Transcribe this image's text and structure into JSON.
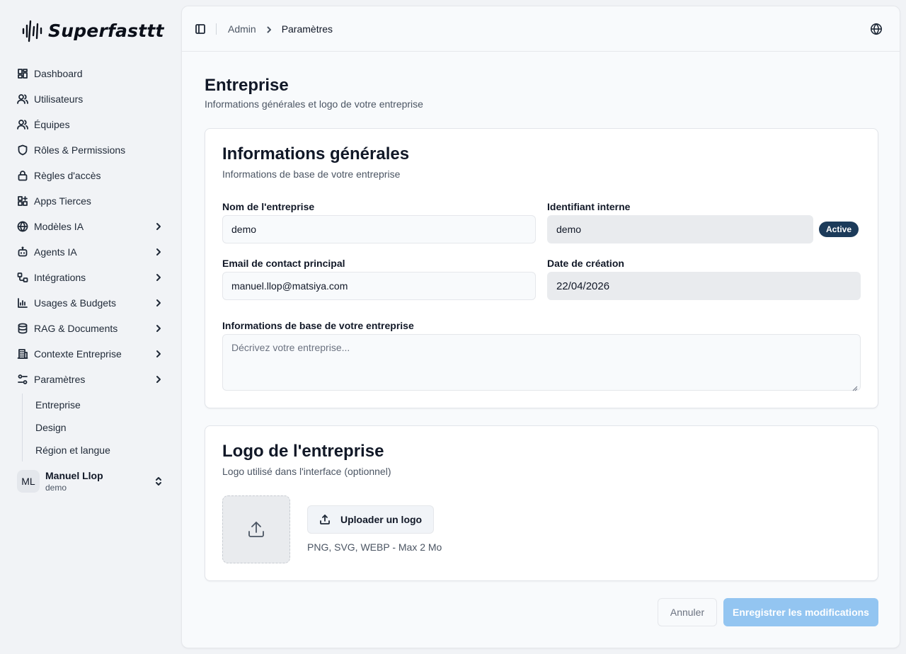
{
  "brand": {
    "name": "Superfasttt"
  },
  "sidebar": {
    "items": [
      {
        "label": "Dashboard",
        "icon": "dashboard-icon",
        "chevron": false
      },
      {
        "label": "Utilisateurs",
        "icon": "users-icon",
        "chevron": false
      },
      {
        "label": "Équipes",
        "icon": "teams-icon",
        "chevron": false
      },
      {
        "label": "Rôles & Permissions",
        "icon": "shield-icon",
        "chevron": false
      },
      {
        "label": "Règles d'accès",
        "icon": "lock-icon",
        "chevron": false
      },
      {
        "label": "Apps Tierces",
        "icon": "apps-icon",
        "chevron": false
      },
      {
        "label": "Modèles IA",
        "icon": "globe-icon",
        "chevron": true
      },
      {
        "label": "Agents IA",
        "icon": "bot-icon",
        "chevron": true
      },
      {
        "label": "Intégrations",
        "icon": "workflow-icon",
        "chevron": true
      },
      {
        "label": "Usages & Budgets",
        "icon": "bar-chart-icon",
        "chevron": true
      },
      {
        "label": "RAG & Documents",
        "icon": "database-icon",
        "chevron": true
      },
      {
        "label": "Contexte Entreprise",
        "icon": "building-icon",
        "chevron": true
      },
      {
        "label": "Paramètres",
        "icon": "settings-sliders-icon",
        "chevron": true
      }
    ],
    "sub_items": [
      "Entreprise",
      "Design",
      "Région et langue"
    ]
  },
  "user": {
    "initials": "ML",
    "name": "Manuel Llop",
    "org": "demo"
  },
  "breadcrumb": {
    "parent": "Admin",
    "current": "Paramètres"
  },
  "page": {
    "title": "Entreprise",
    "subtitle": "Informations générales et logo de votre entreprise"
  },
  "general_card": {
    "title": "Informations générales",
    "subtitle": "Informations de base de votre entreprise",
    "company_name_label": "Nom de l'entreprise",
    "company_name_value": "demo",
    "internal_id_label": "Identifiant interne",
    "internal_id_value": "demo",
    "status_badge": "Active",
    "email_label": "Email de contact principal",
    "email_value": "manuel.llop@matsiya.com",
    "created_label": "Date de création",
    "created_value": "22/04/2026",
    "description_label": "Informations de base de votre entreprise",
    "description_placeholder": "Décrivez votre entreprise..."
  },
  "logo_card": {
    "title": "Logo de l'entreprise",
    "subtitle": "Logo utilisé dans l'interface (optionnel)",
    "upload_label": "Uploader un logo",
    "hint": "PNG, SVG, WEBP - Max 2 Mo"
  },
  "actions": {
    "cancel": "Annuler",
    "save": "Enregistrer les modifications"
  },
  "colors": {
    "badge_bg": "#1c3b5a",
    "save_bg": "#93c5f1"
  }
}
